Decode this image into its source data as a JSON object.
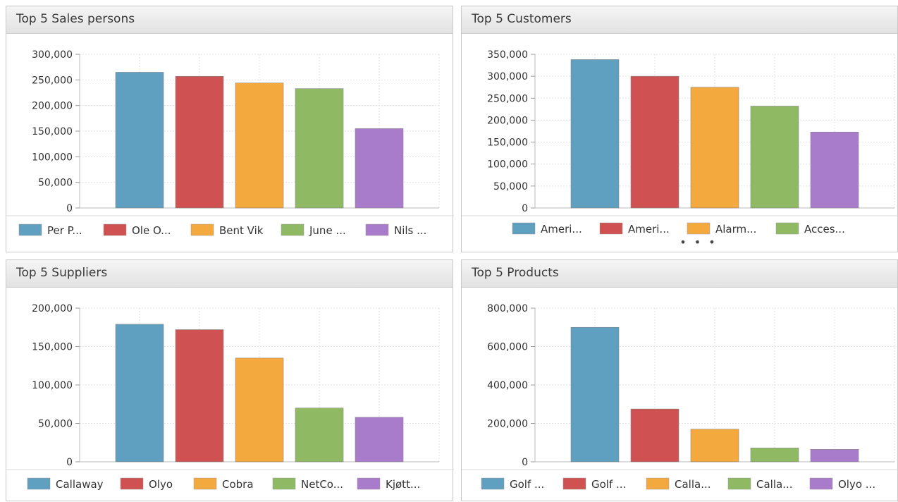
{
  "colors": [
    "#5fa0c0",
    "#cf5151",
    "#f4a93e",
    "#8fba63",
    "#a97bcb"
  ],
  "panels": [
    {
      "title": "Top 5 Sales persons",
      "chart_data": {
        "type": "bar",
        "categories": [
          "Per P...",
          "Ole O...",
          "Bent Vik",
          "June ...",
          "Nils ..."
        ],
        "values": [
          265000,
          257000,
          244000,
          233000,
          155000
        ],
        "ylim": [
          0,
          300000
        ],
        "yticks": [
          0,
          50000,
          100000,
          150000,
          200000,
          250000,
          300000
        ],
        "ytick_labels": [
          "0",
          "50,000",
          "100,000",
          "150,000",
          "200,000",
          "250,000",
          "300,000"
        ],
        "legend": [
          "Per P...",
          "Ole O...",
          "Bent Vik",
          "June ...",
          "Nils ..."
        ],
        "grid": true,
        "legend_position": "bottom"
      }
    },
    {
      "title": "Top 5 Customers",
      "chart_data": {
        "type": "bar",
        "categories": [
          "Ameri...",
          "Ameri...",
          "Alarm...",
          "Acces...",
          ""
        ],
        "values": [
          338000,
          300000,
          275000,
          232000,
          173000
        ],
        "ylim": [
          0,
          350000
        ],
        "yticks": [
          0,
          50000,
          100000,
          150000,
          200000,
          250000,
          300000,
          350000
        ],
        "ytick_labels": [
          "0",
          "50,000",
          "100,000",
          "150,000",
          "200,000",
          "250,000",
          "300,000",
          "350,000"
        ],
        "legend": [
          "Ameri...",
          "Ameri...",
          "Alarm...",
          "Acces..."
        ],
        "legend_more": "• • •",
        "grid": true,
        "legend_position": "bottom"
      }
    },
    {
      "title": "Top 5 Suppliers",
      "chart_data": {
        "type": "bar",
        "categories": [
          "Callaway",
          "Olyo",
          "Cobra",
          "NetCo...",
          "Kjøtt..."
        ],
        "values": [
          179000,
          172000,
          135000,
          70000,
          58000
        ],
        "ylim": [
          0,
          200000
        ],
        "yticks": [
          0,
          50000,
          100000,
          150000,
          200000
        ],
        "ytick_labels": [
          "0",
          "50,000",
          "100,000",
          "150,000",
          "200,000"
        ],
        "legend": [
          "Callaway",
          "Olyo",
          "Cobra",
          "NetCo...",
          "Kjøtt..."
        ],
        "grid": true,
        "legend_position": "bottom"
      }
    },
    {
      "title": "Top 5 Products",
      "chart_data": {
        "type": "bar",
        "categories": [
          "Golf ...",
          "Golf ...",
          "Calla...",
          "Calla...",
          "Olyo ..."
        ],
        "values": [
          700000,
          275000,
          170000,
          72000,
          65000
        ],
        "ylim": [
          0,
          800000
        ],
        "yticks": [
          0,
          200000,
          400000,
          600000,
          800000
        ],
        "ytick_labels": [
          "0",
          "200,000",
          "400,000",
          "600,000",
          "800,000"
        ],
        "legend": [
          "Golf ...",
          "Golf ...",
          "Calla...",
          "Calla...",
          "Olyo ..."
        ],
        "grid": true,
        "legend_position": "bottom"
      }
    }
  ]
}
